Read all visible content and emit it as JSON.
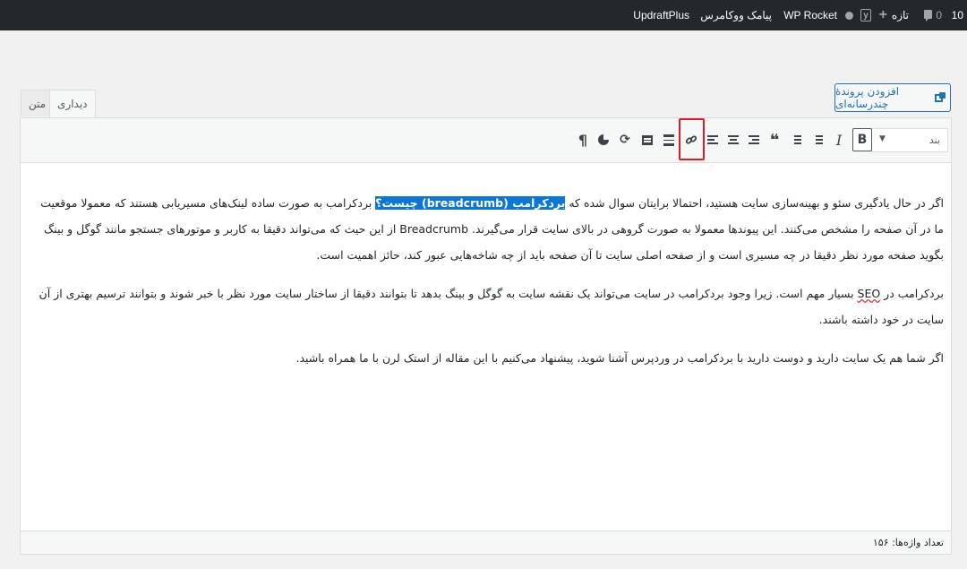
{
  "adminbar": {
    "count": "10",
    "comments": "0",
    "new": "تازه",
    "wp_rocket": "WP Rocket",
    "sms": "پیامک ووکامرس",
    "updraft": "UpdraftPlus"
  },
  "tabs": {
    "visual": "دیداری",
    "text": "متن"
  },
  "add_media": "افزودن پروندهٔ چندرسانه‌ای",
  "toolbar": {
    "format_value": "بند",
    "bold": "B",
    "italic": "I",
    "blockquote": "❝",
    "more_more": "¶"
  },
  "content": {
    "p1_a": "اگر در حال یادگیری سئو و بهینه‌سازی سایت هستید، احتمالا برایتان سوال شده که ",
    "p1_sel": "بردکرامب (breadcrumb) چیست؟",
    "p1_b": " بردکرامب به صورت ساده لینک‌های مسیریابی هستند که معمولا موقعیت ما در آن صفحه را مشخص می‌کنند. این پیوندها معمولا به صورت گروهی در بالای سایت قرار می‌گیرند. Breadcrumb از این حیث که می‌تواند دقیقا به کاربر و موتورهای جستجو مانند گوگل و بینگ بگوید صفحه مورد نظر دقیقا در چه مسیری است و از صفحه اصلی سایت تا آن صفحه باید از چه شاخه‌هایی عبور کند، حائز اهمیت است.",
    "p2_a": "بردکرامب در ",
    "p2_seo": "SEO",
    "p2_b": " بسیار مهم است. زیرا وجود بردکرامب در سایت می‌تواند یک نقشه سایت به گوگل و بینگ بدهد تا بتوانند دقیقا از ساختار سایت مورد نظر با خبر شوند و بتوانند ترسیم بهتری از آن سایت در خود داشته باشند.",
    "p3": "اگر شما هم یک سایت دارید و دوست دارید با بردکرامب در وردپرس آشنا شوید، پیشنهاد می‌کنیم با این مقاله از استک لرن با ما همراه باشید."
  },
  "status": {
    "word_count": "تعداد واژه‌ها: ۱۵۶"
  }
}
